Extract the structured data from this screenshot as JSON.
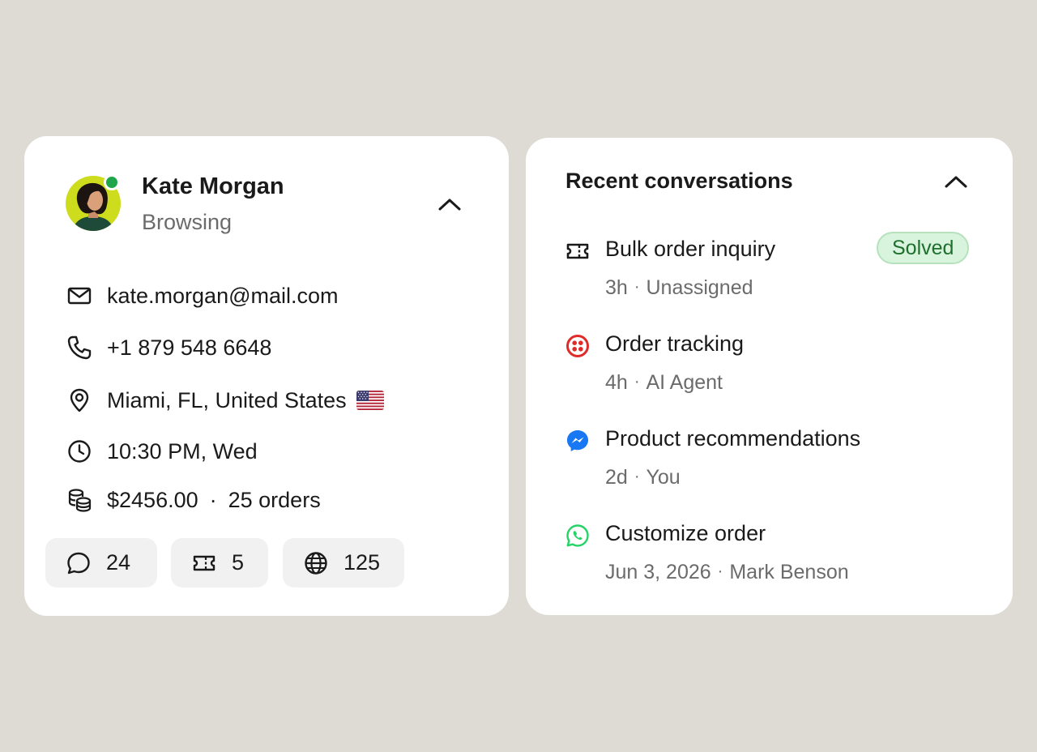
{
  "profile": {
    "name": "Kate Morgan",
    "status": "Browsing",
    "presence_color": "#1fa64a",
    "avatar_bg": "#cddc1c",
    "details": {
      "email": "kate.morgan@mail.com",
      "phone": "+1 879 548 6648",
      "location": "Miami, FL, United States",
      "local_time": "10:30 PM, Wed",
      "spent": "$2456.00",
      "separator": "·",
      "orders": "25 orders"
    },
    "stats": {
      "conversations": "24",
      "tickets": "5",
      "page_views": "125"
    }
  },
  "conversations": {
    "title": "Recent conversations",
    "separator": "·",
    "items": [
      {
        "channel_icon": "ticket-icon",
        "title": "Bulk order inquiry",
        "age": "3h",
        "assignee": "Unassigned",
        "badge": "Solved"
      },
      {
        "channel_icon": "twilio-icon",
        "title": "Order tracking",
        "age": "4h",
        "assignee": "AI Agent"
      },
      {
        "channel_icon": "messenger-icon",
        "title": "Product recommendations",
        "age": "2d",
        "assignee": "You"
      },
      {
        "channel_icon": "whatsapp-icon",
        "title": "Customize order",
        "age": "Jun 3, 2026",
        "assignee": "Mark Benson"
      }
    ]
  },
  "colors": {
    "background": "#dddbd4",
    "card": "#ffffff",
    "chip": "#f1f1f1",
    "secondary_text": "#6b6b6b",
    "solved_bg": "#d9f4dd",
    "solved_text": "#1f6f2e",
    "twilio_red": "#e02b2b",
    "messenger_blue": "#1877f2",
    "whatsapp_green": "#25d366"
  }
}
